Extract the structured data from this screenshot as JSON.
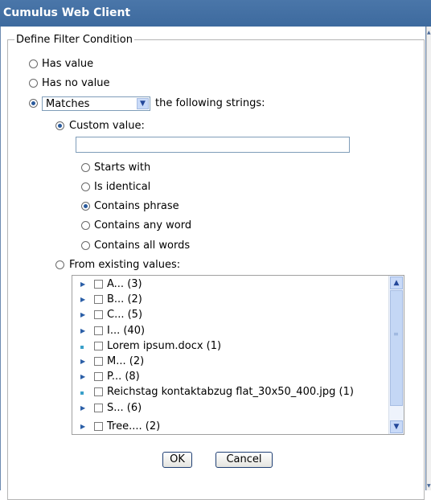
{
  "window": {
    "title": "Cumulus Web Client"
  },
  "dialog": {
    "legend": "Define Filter Condition",
    "options": {
      "has_value": "Has value",
      "has_no_value": "Has no value",
      "matches_suffix": "the following strings:"
    },
    "match_select": {
      "selected": "Matches"
    },
    "custom_value": {
      "label": "Custom value:",
      "input_value": "",
      "modes": [
        {
          "label": "Starts with",
          "selected": false
        },
        {
          "label": "Is identical",
          "selected": false
        },
        {
          "label": "Contains phrase",
          "selected": true
        },
        {
          "label": "Contains any word",
          "selected": false
        },
        {
          "label": "Contains all words",
          "selected": false
        }
      ]
    },
    "existing_values": {
      "label": "From existing values:",
      "items": [
        {
          "text": "A... (3)",
          "marker": "expand-arrow"
        },
        {
          "text": "B... (2)",
          "marker": "expand-arrow"
        },
        {
          "text": "C... (5)",
          "marker": "expand-arrow"
        },
        {
          "text": "I... (40)",
          "marker": "expand-arrow"
        },
        {
          "text": "Lorem ipsum.docx (1)",
          "marker": "leaf-dot"
        },
        {
          "text": "M... (2)",
          "marker": "expand-arrow"
        },
        {
          "text": "P... (8)",
          "marker": "expand-arrow"
        },
        {
          "text": "Reichstag kontaktabzug flat_30x50_400.jpg (1)",
          "marker": "leaf-dot"
        },
        {
          "text": "S... (6)",
          "marker": "expand-arrow"
        },
        {
          "text": "Tree.... (2)",
          "marker": "expand-arrow"
        }
      ]
    },
    "buttons": {
      "ok": "OK",
      "cancel": "Cancel"
    }
  }
}
